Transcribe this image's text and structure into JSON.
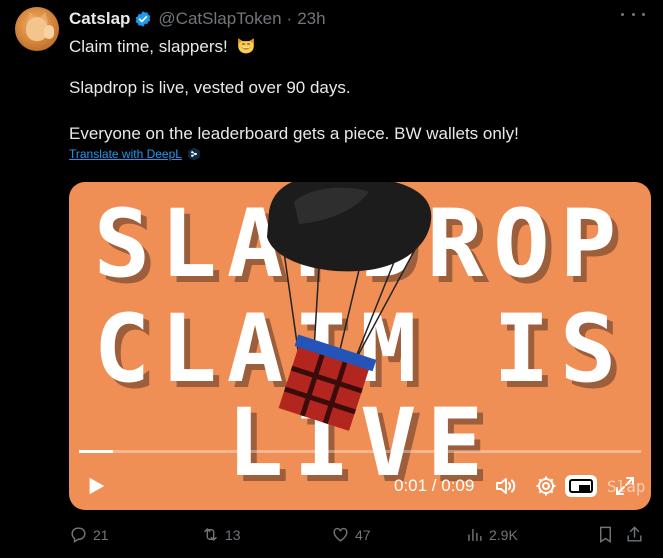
{
  "tweet": {
    "display_name": "Catslap",
    "handle": "@CatSlapToken",
    "separator": "·",
    "time": "23h",
    "line1": "Claim time, slappers!",
    "line2": "Slapdrop is live, vested over 90 days.",
    "line3": "Everyone on the leaderboard gets a piece. BW wallets only!",
    "translate_label": "Translate with DeepL"
  },
  "media": {
    "line1": "SLAPDROP",
    "line2": "CLAIM IS",
    "line3": "LIVE",
    "background": "#f08f55",
    "timecode": "0:01 / 0:09",
    "progress": 0.06,
    "ghost_watermark": "Slap"
  },
  "actions": {
    "replies": "21",
    "reposts": "13",
    "likes": "47",
    "views": "2.9K"
  },
  "colors": {
    "accent": "#1d9bf0",
    "muted": "#71767b",
    "text": "#e7e9ea"
  }
}
